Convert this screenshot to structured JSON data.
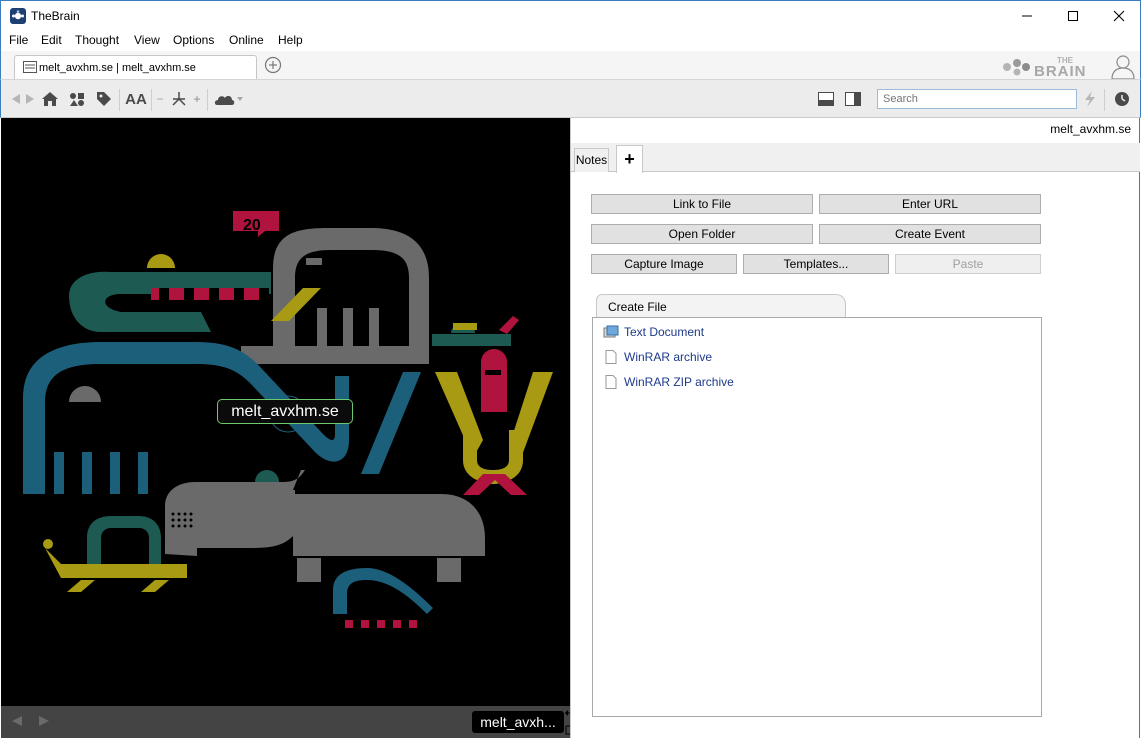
{
  "window": {
    "title": "TheBrain",
    "controls": [
      "minimize",
      "maximize",
      "close"
    ]
  },
  "menu": [
    "File",
    "Edit",
    "Thought",
    "View",
    "Options",
    "Online",
    "Help"
  ],
  "tabs": {
    "document_tab": "melt_avxhm.se | melt_avxhm.se"
  },
  "brand": {
    "logo_top": "THE",
    "logo_bottom": "BRAIN"
  },
  "toolbar": {
    "text_size_label": "AA",
    "minus": "−",
    "plus": "+",
    "search_placeholder": "Search"
  },
  "plex": {
    "active_thought": "melt_avxhm.se",
    "badge_number": "20",
    "footer_label": "melt_avxh..."
  },
  "right_panel": {
    "thought_name": "melt_avxhm.se",
    "tabs": {
      "notes": "Notes",
      "add": "+"
    },
    "buttons": {
      "link_to_file": "Link to File",
      "enter_url": "Enter URL",
      "open_folder": "Open Folder",
      "create_event": "Create Event",
      "capture_image": "Capture Image",
      "templates": "Templates...",
      "paste": "Paste"
    },
    "create_file": {
      "tab_label": "Create File",
      "items": [
        "Text Document",
        "WinRAR archive",
        "WinRAR ZIP archive"
      ]
    }
  },
  "colors": {
    "window_border": "#3b7ec0",
    "plex_background": "#000000",
    "thought_outline": "#6cc96c",
    "link_text": "#1e3a8a"
  }
}
